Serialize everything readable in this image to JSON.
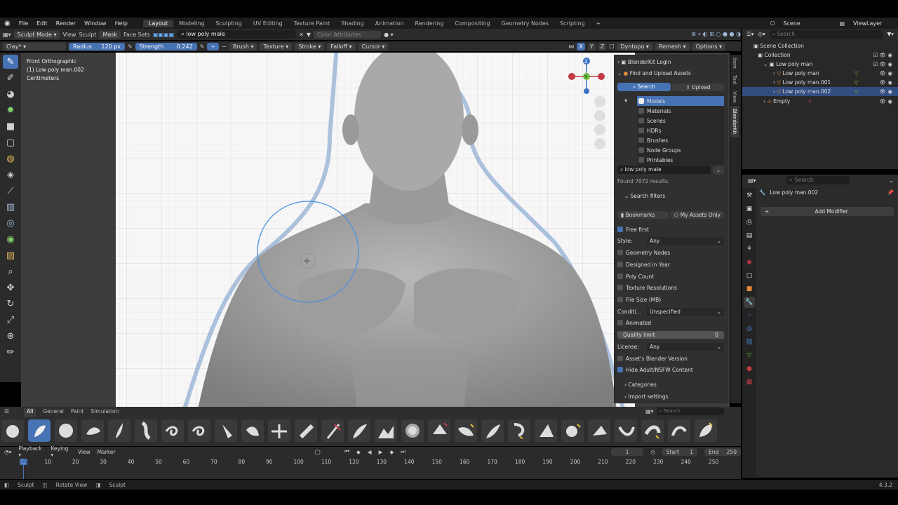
{
  "menu": [
    "File",
    "Edit",
    "Render",
    "Window",
    "Help"
  ],
  "workspaces": [
    "Layout",
    "Modeling",
    "Sculpting",
    "UV Editing",
    "Texture Paint",
    "Shading",
    "Animation",
    "Rendering",
    "Compositing",
    "Geometry Nodes",
    "Scripting"
  ],
  "active_workspace": "Layout",
  "scene_name": "Scene",
  "view_layer": "ViewLayer",
  "header1": {
    "mode": "Sculpt Mode",
    "view": "View",
    "sculpt": "Sculpt",
    "mask": "Mask",
    "face_sets": "Face Sets",
    "search_value": "low poly male",
    "color_attributes": "Color Attributes"
  },
  "header2": {
    "brush_name": "Clay*",
    "radius_label": "Radius",
    "radius_value": "120 px",
    "strength_label": "Strength",
    "strength_value": "0.242",
    "brush": "Brush",
    "texture": "Texture",
    "stroke": "Stroke",
    "falloff": "Falloff",
    "cursor": "Cursor",
    "x": "X",
    "y": "Y",
    "z": "Z",
    "dyntopo": "Dyntopo",
    "remesh": "Remesh",
    "options": "Options"
  },
  "viewport_info": {
    "line1": "Front Orthographic",
    "line2": "(1) Low poly man.002",
    "line3": "Centimeters"
  },
  "gizmo": {
    "z": "Z",
    "y": "Y"
  },
  "npanel": {
    "login": "BlenderKit Login",
    "find_upload": "Find and Upload Assets",
    "search_tab": "Search",
    "upload_tab": "Upload",
    "categories": [
      "Models",
      "Materials",
      "Scenes",
      "HDRs",
      "Brushes",
      "Node Groups",
      "Printables"
    ],
    "search_value": "low poly male",
    "results": "Found 7072 results.",
    "search_filters": "Search filters",
    "bookmarks": "Bookmarks",
    "my_assets": "My Assets Only",
    "free_first": "Free first",
    "style_label": "Style:",
    "style_value": "Any",
    "geometry_nodes": "Geometry Nodes",
    "designed_in_year": "Designed in Year",
    "poly_count": "Poly Count",
    "texture_res": "Texture Resolutions",
    "file_size": "File Size (MB)",
    "condition_label": "Conditi...",
    "condition_value": "Unspecified",
    "animated": "Animated",
    "quality_label": "Quality limit",
    "quality_value": "0",
    "license_label": "License:",
    "license_value": "Any",
    "asset_version": "Asset's Blender Version",
    "hide_adult": "Hide Adult/NSFW Content",
    "categories_label": "Categories",
    "import_settings": "Import settings"
  },
  "side_tabs": [
    "Item",
    "Tool",
    "View",
    "BlenderKit"
  ],
  "outliner": {
    "search_placeholder": "Search",
    "rows": [
      "Scene Collection",
      "Collection",
      "Low poly man",
      "Low poly man",
      "Low poly man.001",
      "Low poly man.002",
      "Empty"
    ]
  },
  "properties": {
    "search_placeholder": "Search",
    "object_name": "Low poly man.002",
    "add_modifier": "Add Modifier"
  },
  "brush_tabs": [
    "All",
    "General",
    "Paint",
    "Simulation"
  ],
  "brush_search_placeholder": "Search",
  "timeline": {
    "playback": "Playback",
    "keying": "Keying",
    "view": "View",
    "marker": "Marker",
    "current_frame": "1",
    "start_label": "Start",
    "start_value": "1",
    "end_label": "End",
    "end_value": "250",
    "ticks": [
      "1",
      "10",
      "20",
      "30",
      "40",
      "50",
      "60",
      "70",
      "80",
      "90",
      "100",
      "110",
      "120",
      "130",
      "140",
      "150",
      "160",
      "170",
      "180",
      "190",
      "200",
      "210",
      "220",
      "230",
      "240",
      "250"
    ]
  },
  "status": [
    "Sculpt",
    "Rotate View",
    "Sculpt"
  ],
  "version": "4.3.2",
  "colors": {
    "accent": "#4772b3",
    "panel": "#303030",
    "header": "#2b2b2b",
    "viewport_bg": "#3d3d3d"
  }
}
